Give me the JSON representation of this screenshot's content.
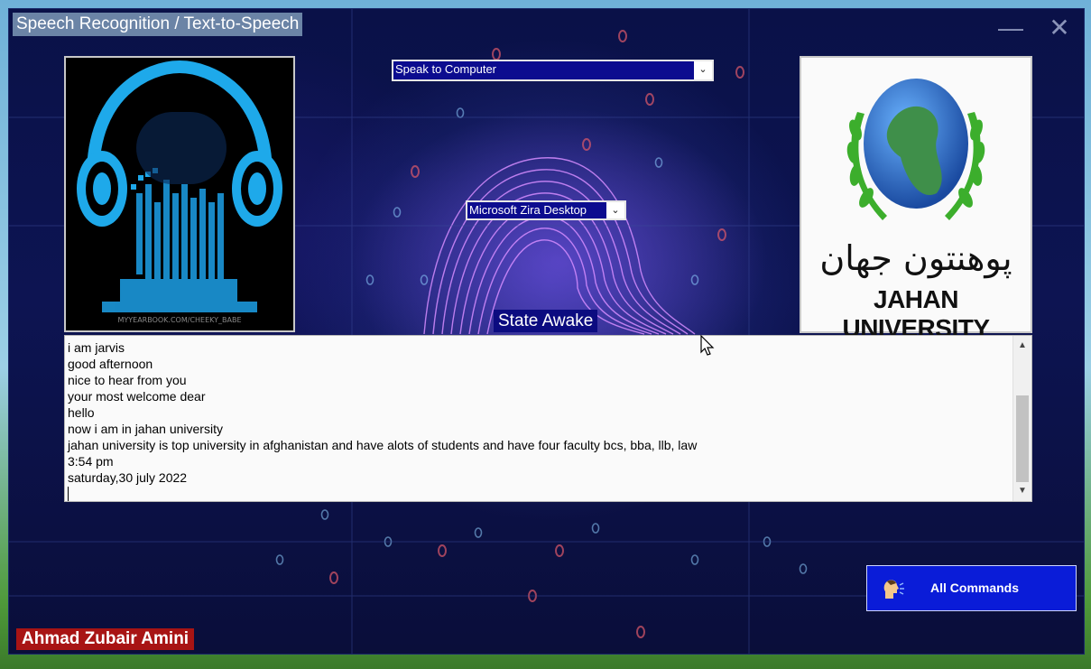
{
  "window": {
    "title": "Speech Recognition / Text-to-Speech",
    "minimize_glyph": "—",
    "close_glyph": "✕"
  },
  "selects": {
    "mode_value": "Speak to Computer",
    "voice_value": "Microsoft Zira Desktop",
    "arrow_glyph": "⌄"
  },
  "left_image": {
    "icon": "headphones-head-icon",
    "watermark": "MYYEARBOOK.COM/CHEEKY_BABE"
  },
  "logo": {
    "icon": "globe-laurel-icon",
    "name_farsi": "پوهنتون جهان",
    "name_english": "JAHAN UNIVERSITY"
  },
  "status": {
    "state": "State Awake"
  },
  "transcript": {
    "lines": [
      "i am jarvis",
      "good afternoon",
      "nice to hear from you",
      "your most welcome dear",
      "hello",
      "now i am in jahan university",
      "jahan university is top university in afghanistan and have alots of students and have four faculty bcs, bba, llb, law",
      "3:54 pm",
      "saturday,30 july 2022"
    ]
  },
  "commands_button": {
    "label": "All Commands",
    "icon": "speaking-head-icon"
  },
  "footer": {
    "author": "Ahmad Zubair Amini"
  },
  "colors": {
    "window_bg": "#0d1452",
    "select_bg": "#0c0c8f",
    "button_bg": "#0a1cd8",
    "author_bg": "#a81414",
    "title_bg": "#6b84a6",
    "accent_cyan": "#17a4e8"
  }
}
